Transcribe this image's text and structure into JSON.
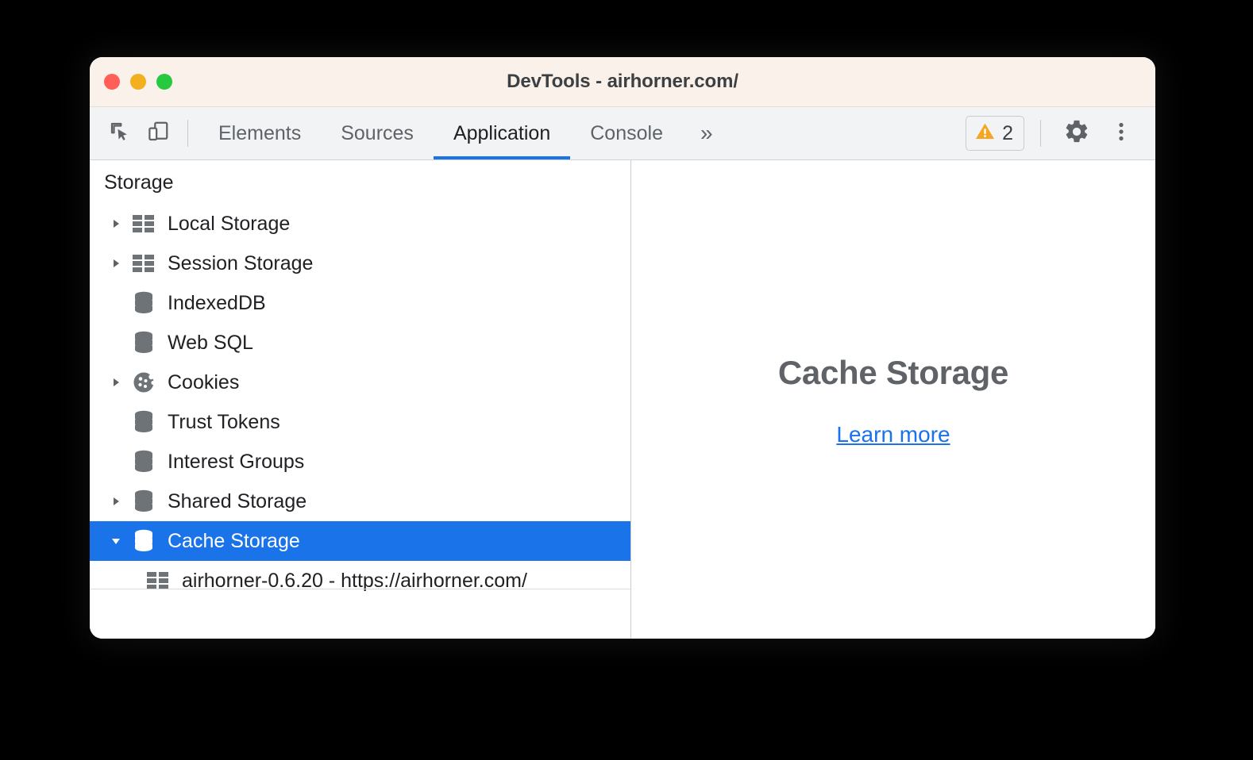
{
  "window": {
    "title": "DevTools - airhorner.com/",
    "traffic_lights": [
      {
        "name": "close",
        "color": "#ff5f56"
      },
      {
        "name": "minimize",
        "color": "#f2b01e"
      },
      {
        "name": "maximize",
        "color": "#27c93f"
      }
    ]
  },
  "toolbar": {
    "inspect_icon": "inspect-element-icon",
    "device_icon": "device-toolbar-icon",
    "tabs": [
      {
        "label": "Elements",
        "active": false
      },
      {
        "label": "Sources",
        "active": false
      },
      {
        "label": "Application",
        "active": true
      },
      {
        "label": "Console",
        "active": false
      }
    ],
    "more_tabs_label": "»",
    "warning_icon": "warning-triangle-icon",
    "warning_count": "2",
    "settings_icon": "gear-icon",
    "menu_icon": "three-dots-vertical-icon",
    "accent_color": "#1a73e8"
  },
  "sidebar": {
    "section_title": "Storage",
    "items": [
      {
        "label": "Local Storage",
        "icon": "table-grid-icon",
        "expandable": true,
        "expanded": false,
        "selected": false,
        "level": 1
      },
      {
        "label": "Session Storage",
        "icon": "table-grid-icon",
        "expandable": true,
        "expanded": false,
        "selected": false,
        "level": 1
      },
      {
        "label": "IndexedDB",
        "icon": "database-icon",
        "expandable": false,
        "expanded": false,
        "selected": false,
        "level": 1
      },
      {
        "label": "Web SQL",
        "icon": "database-icon",
        "expandable": false,
        "expanded": false,
        "selected": false,
        "level": 1
      },
      {
        "label": "Cookies",
        "icon": "cookie-icon",
        "expandable": true,
        "expanded": false,
        "selected": false,
        "level": 1
      },
      {
        "label": "Trust Tokens",
        "icon": "database-icon",
        "expandable": false,
        "expanded": false,
        "selected": false,
        "level": 1
      },
      {
        "label": "Interest Groups",
        "icon": "database-icon",
        "expandable": false,
        "expanded": false,
        "selected": false,
        "level": 1
      },
      {
        "label": "Shared Storage",
        "icon": "database-icon",
        "expandable": true,
        "expanded": false,
        "selected": false,
        "level": 1
      },
      {
        "label": "Cache Storage",
        "icon": "database-icon",
        "expandable": true,
        "expanded": true,
        "selected": true,
        "level": 1
      },
      {
        "label": "airhorner-0.6.20 - https://airhorner.com/",
        "icon": "table-grid-icon",
        "expandable": false,
        "expanded": false,
        "selected": false,
        "level": 2
      }
    ],
    "selection_color": "#1a73e8"
  },
  "content": {
    "empty_state_title": "Cache Storage",
    "learn_more_label": "Learn more",
    "link_color": "#1a73e8"
  }
}
